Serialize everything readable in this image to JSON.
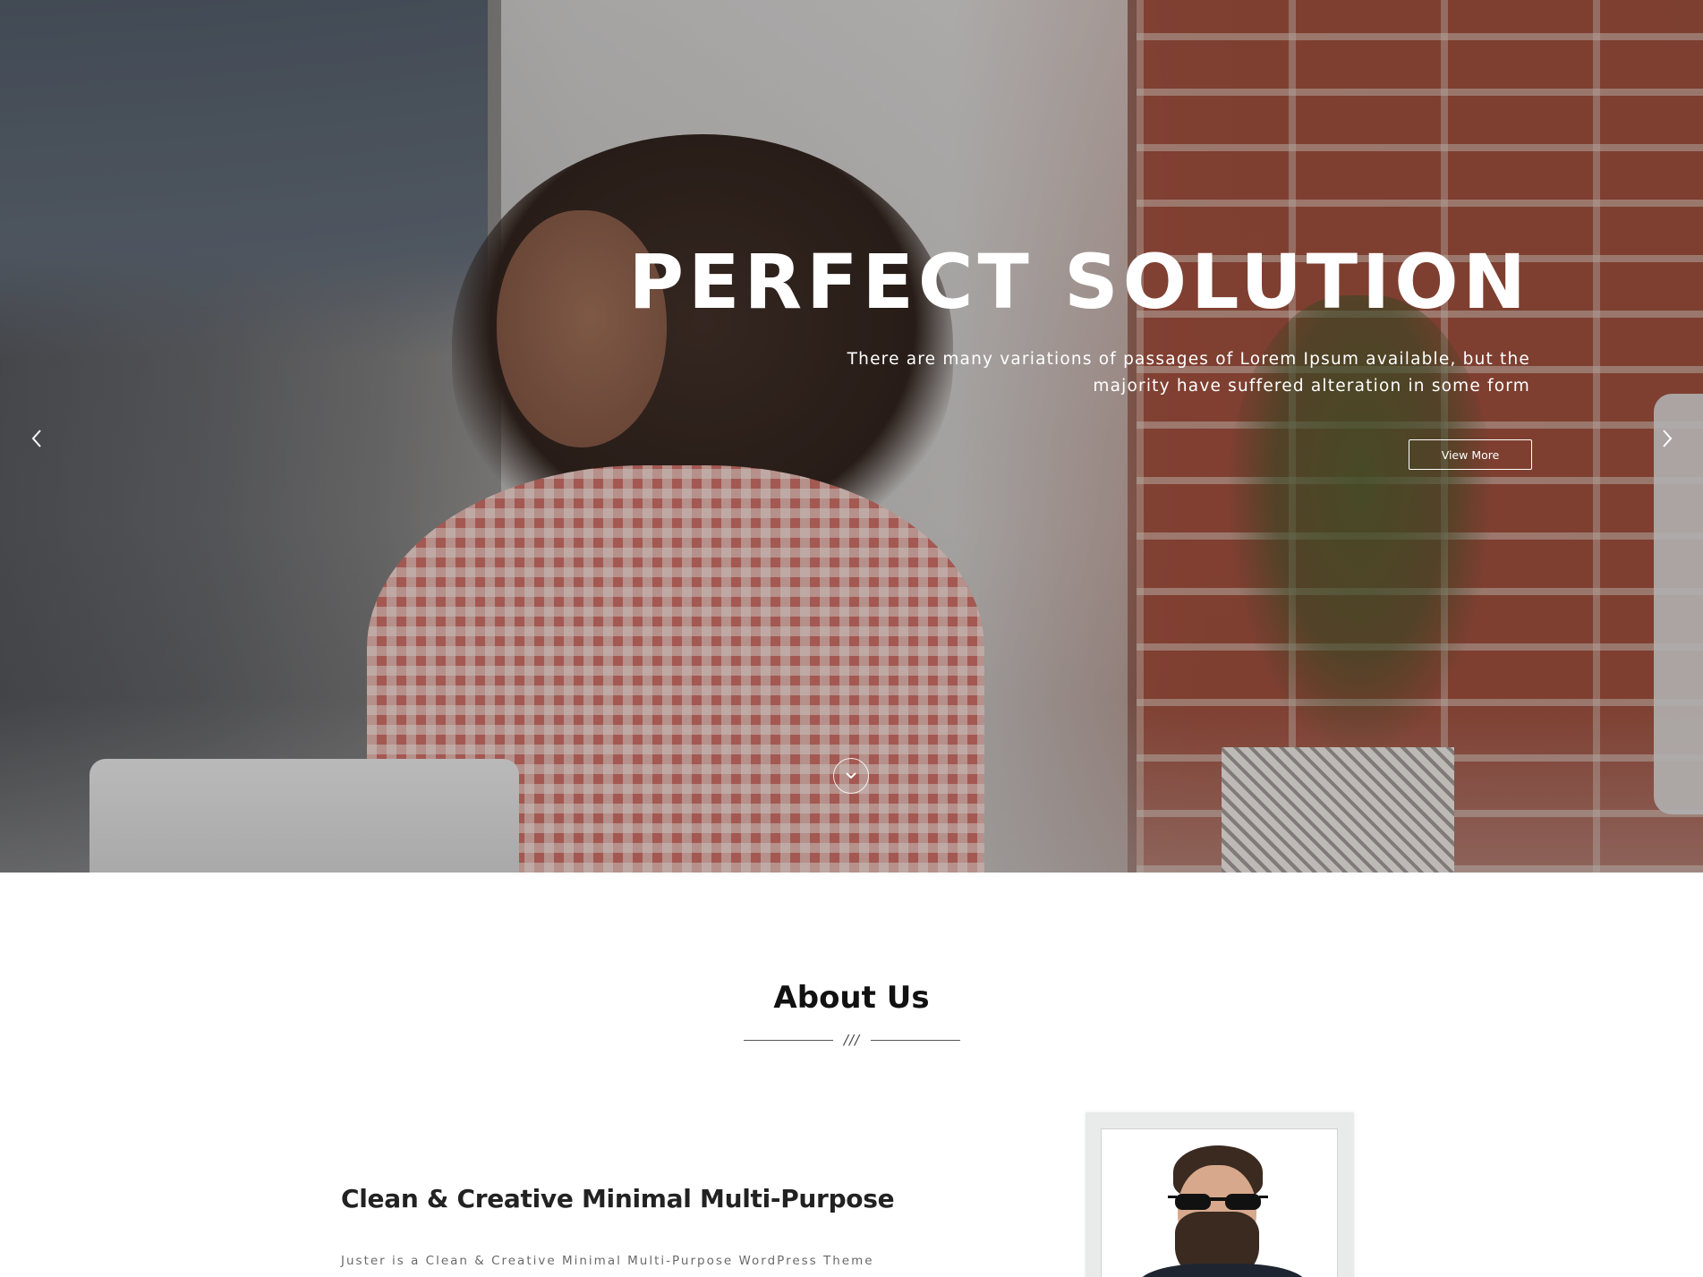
{
  "hero": {
    "title": "PERFECT SOLUTION",
    "subtitle_line1": "There are many variations of passages of Lorem Ipsum available, but the",
    "subtitle_line2": "majority have suffered alteration in some form",
    "button_label": "View More",
    "prev_icon": "chevron-left-icon",
    "next_icon": "chevron-right-icon",
    "scroll_icon": "chevron-down-circle-icon"
  },
  "about": {
    "title": "About Us",
    "divider_mark": "///",
    "heading": "Clean & Creative Minimal Multi-Purpose",
    "text": "Juster is a Clean & Creative Minimal Multi-Purpose WordPress Theme"
  },
  "colors": {
    "text_dark": "#111111",
    "text_muted": "#6a6a6a",
    "hero_text": "#ffffff",
    "frame": "#e9ebeb"
  }
}
